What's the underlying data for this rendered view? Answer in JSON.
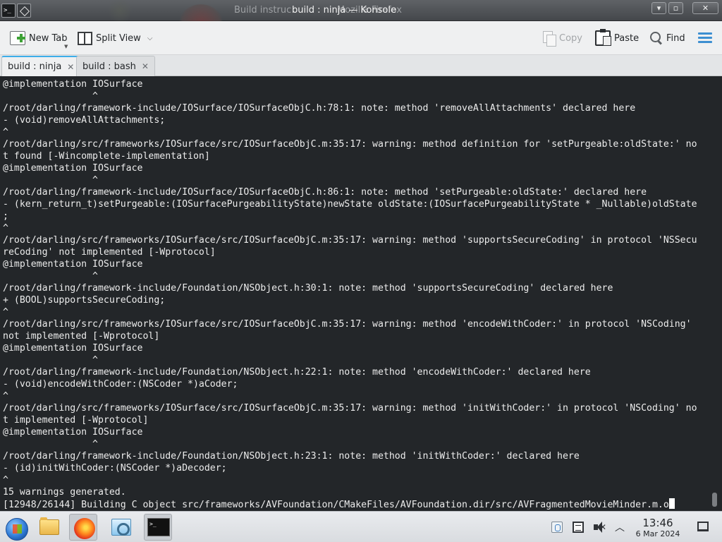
{
  "window": {
    "title": "build : ninja — Konsole",
    "ghost_title_left": "Build instruc",
    "ghost_title_right": "Mozilla Firefox",
    "app_icon_label": ">_",
    "minimize_label": "▾",
    "maximize_label": "▫",
    "close_label": "✕"
  },
  "toolbar": {
    "new_tab_label": "New Tab",
    "split_view_label": "Split View",
    "copy_label": "Copy",
    "paste_label": "Paste",
    "find_label": "Find"
  },
  "tabs": [
    {
      "label": "build : ninja",
      "active": true,
      "close": "✕"
    },
    {
      "label": "build : bash",
      "active": false,
      "close": "✕"
    }
  ],
  "terminal": {
    "lines": [
      "@implementation IOSurface",
      "                ^",
      "/root/darling/framework-include/IOSurface/IOSurfaceObjC.h:78:1: note: method 'removeAllAttachments' declared here",
      "- (void)removeAllAttachments;",
      "^",
      "/root/darling/src/frameworks/IOSurface/src/IOSurfaceObjC.m:35:17: warning: method definition for 'setPurgeable:oldState:' no",
      "t found [-Wincomplete-implementation]",
      "@implementation IOSurface",
      "                ^",
      "/root/darling/framework-include/IOSurface/IOSurfaceObjC.h:86:1: note: method 'setPurgeable:oldState:' declared here",
      "- (kern_return_t)setPurgeable:(IOSurfacePurgeabilityState)newState oldState:(IOSurfacePurgeabilityState * _Nullable)oldState",
      ";",
      "^",
      "/root/darling/src/frameworks/IOSurface/src/IOSurfaceObjC.m:35:17: warning: method 'supportsSecureCoding' in protocol 'NSSecu",
      "reCoding' not implemented [-Wprotocol]",
      "@implementation IOSurface",
      "                ^",
      "/root/darling/framework-include/Foundation/NSObject.h:30:1: note: method 'supportsSecureCoding' declared here",
      "+ (BOOL)supportsSecureCoding;",
      "^",
      "/root/darling/src/frameworks/IOSurface/src/IOSurfaceObjC.m:35:17: warning: method 'encodeWithCoder:' in protocol 'NSCoding'",
      "not implemented [-Wprotocol]",
      "@implementation IOSurface",
      "                ^",
      "/root/darling/framework-include/Foundation/NSObject.h:22:1: note: method 'encodeWithCoder:' declared here",
      "- (void)encodeWithCoder:(NSCoder *)aCoder;",
      "^",
      "/root/darling/src/frameworks/IOSurface/src/IOSurfaceObjC.m:35:17: warning: method 'initWithCoder:' in protocol 'NSCoding' no",
      "t implemented [-Wprotocol]",
      "@implementation IOSurface",
      "                ^",
      "/root/darling/framework-include/Foundation/NSObject.h:23:1: note: method 'initWithCoder:' declared here",
      "- (id)initWithCoder:(NSCoder *)aDecoder;",
      "^",
      "15 warnings generated.",
      "[12948/26144] Building C object src/frameworks/AVFoundation/CMakeFiles/AVFoundation.dir/src/AVFragmentedMovieMinder.m.o"
    ]
  },
  "taskbar": {
    "console_icon_label": ">_",
    "time": "13:46",
    "date": "6 Mar 2024",
    "mute_glyph": "✕",
    "expand_glyph": "︿"
  }
}
